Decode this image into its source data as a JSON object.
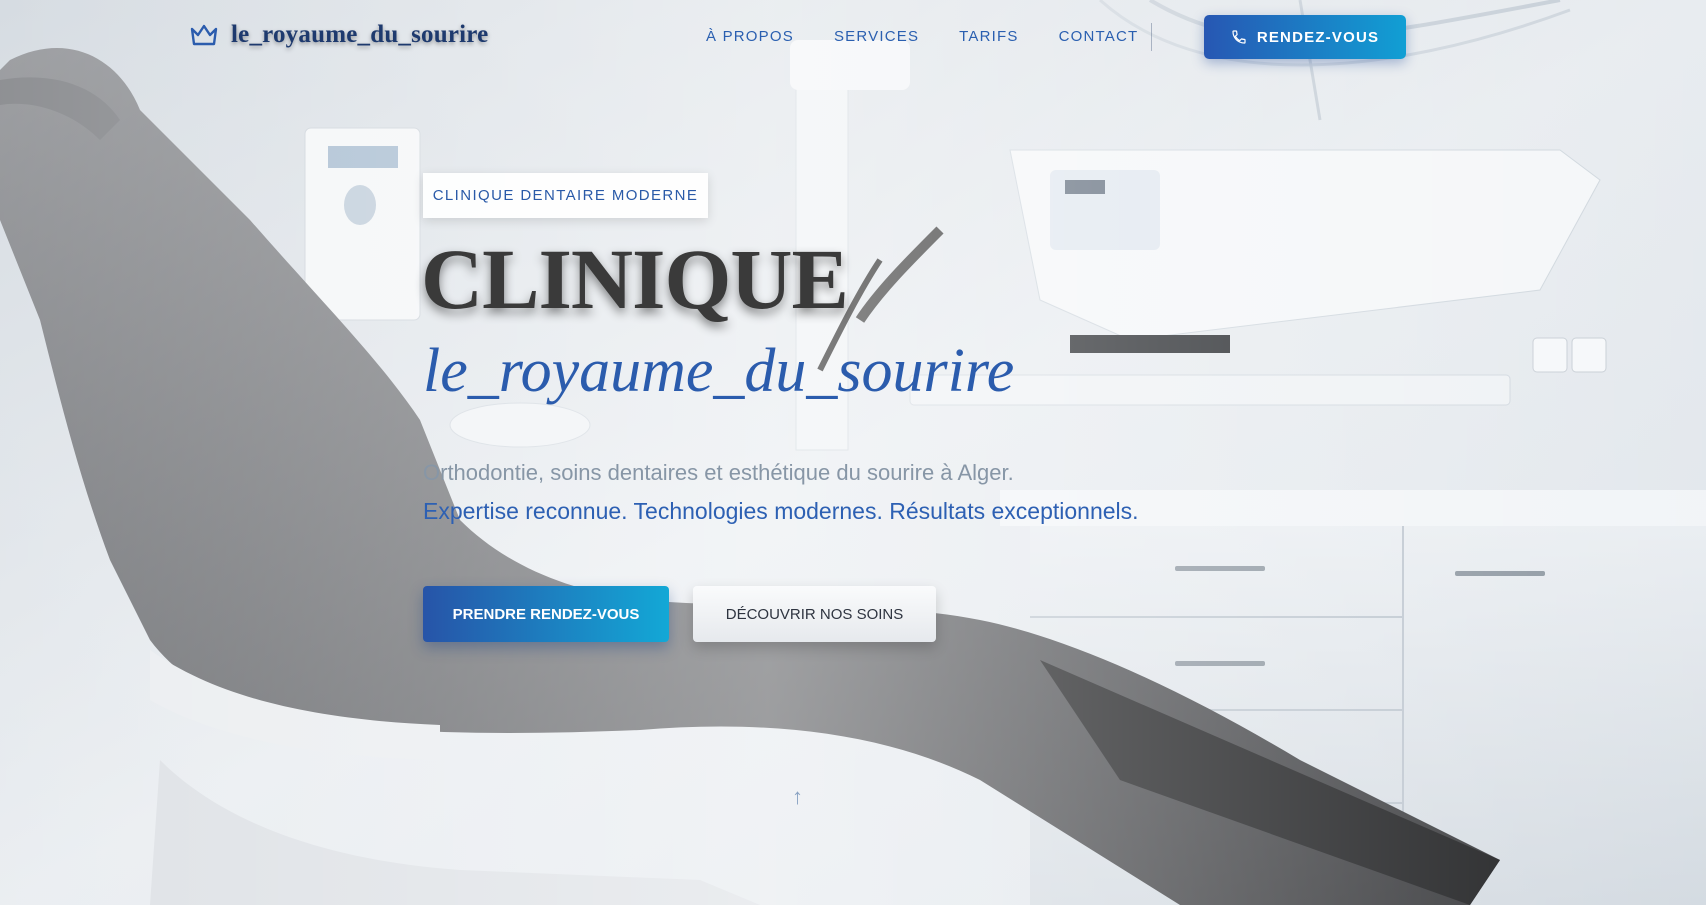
{
  "brand": {
    "name": "le_royaume_du_sourire",
    "icon": "crown-icon",
    "color": "#1e3a6e"
  },
  "nav": {
    "items": [
      {
        "label": "À PROPOS"
      },
      {
        "label": "SERVICES"
      },
      {
        "label": "TARIFS"
      },
      {
        "label": "CONTACT"
      }
    ],
    "cta": {
      "label": "RENDEZ-VOUS",
      "icon": "phone-icon"
    }
  },
  "hero": {
    "badge": "CLINIQUE DENTAIRE MODERNE",
    "title": "CLINIQUE",
    "subtitle": "le_royaume_du_sourire",
    "description": "Orthodontie, soins dentaires et esthétique du sourire à Alger.",
    "tagline": "Expertise reconnue. Technologies modernes. Résultats exceptionnels.",
    "primary_button": "PRENDRE RENDEZ-VOUS",
    "secondary_button": "DÉCOUVRIR NOS SOINS",
    "scroll_icon": "arrow-up-icon"
  },
  "colors": {
    "accent_start": "#2757b3",
    "accent_end": "#119fd4",
    "text_blue": "#2b5cad"
  }
}
